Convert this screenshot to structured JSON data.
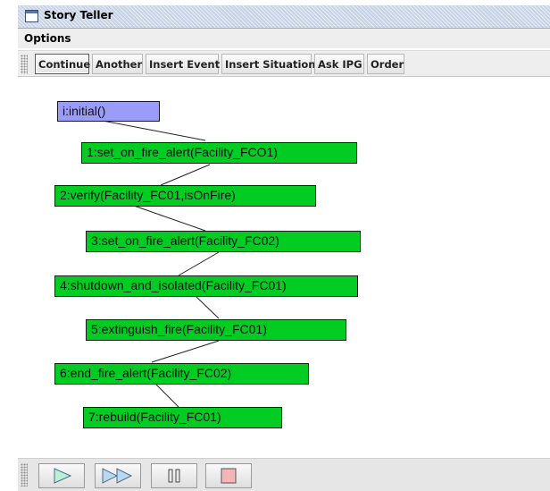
{
  "window": {
    "title": "Story Teller",
    "icon": "window-icon"
  },
  "menubar": {
    "items": [
      {
        "label": "Options"
      }
    ]
  },
  "toolbar": {
    "buttons": [
      {
        "label": "Continue",
        "focused": true
      },
      {
        "label": "Another"
      },
      {
        "label": "Insert Event"
      },
      {
        "label": "Insert Situation"
      },
      {
        "label": "Ask IPG"
      },
      {
        "label": "Order"
      }
    ]
  },
  "graph": {
    "nodes": [
      {
        "label": "i:initial()",
        "kind": "initial"
      },
      {
        "label": "1:set_on_fire_alert(Facility_FCO1)",
        "kind": "event"
      },
      {
        "label": "2:verify(Facility_FC01,isOnFire)",
        "kind": "event"
      },
      {
        "label": "3:set_on_fire_alert(Facility_FC02)",
        "kind": "event"
      },
      {
        "label": "4:shutdown_and_isolated(Facility_FC01)",
        "kind": "event"
      },
      {
        "label": "5:extinguish_fire(Facility_FC01)",
        "kind": "event"
      },
      {
        "label": "6:end_fire_alert(Facility_FC02)",
        "kind": "event"
      },
      {
        "label": "7:rebuild(Facility_FC01)",
        "kind": "event"
      }
    ],
    "colors": {
      "initial": "#9a9cfa",
      "event": "#00cc22",
      "border": "#1c1c1c"
    }
  },
  "playback": {
    "buttons": [
      {
        "name": "play-button",
        "icon": "play-icon"
      },
      {
        "name": "fast-forward-button",
        "icon": "fast-forward-icon"
      },
      {
        "name": "pause-button",
        "icon": "pause-icon"
      },
      {
        "name": "stop-button",
        "icon": "stop-icon"
      }
    ],
    "colors": {
      "play": "#b9f0d6",
      "stop": "#f3b5b5"
    }
  }
}
